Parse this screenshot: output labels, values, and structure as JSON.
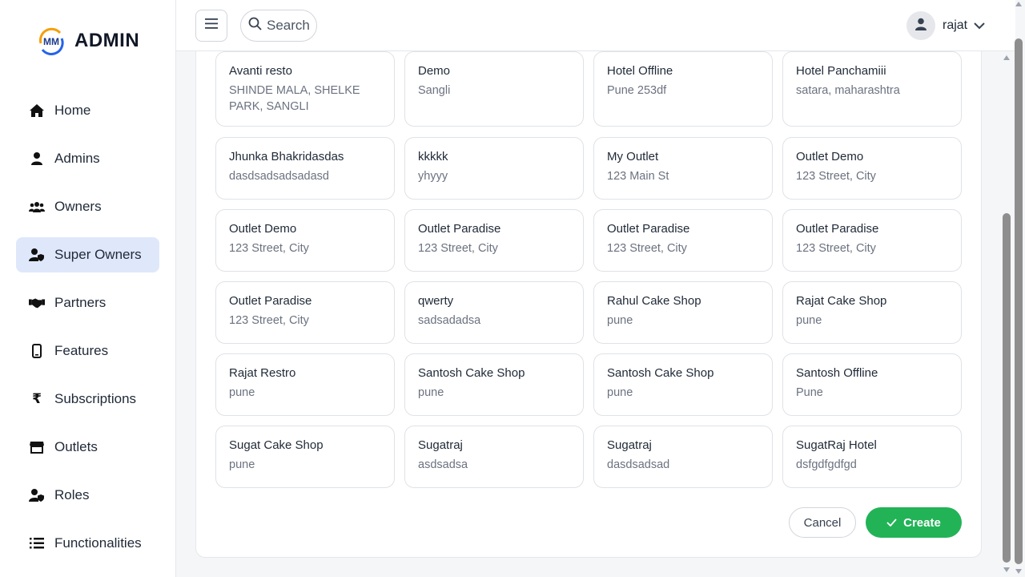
{
  "brand": {
    "logo_text": "MM",
    "title": "ADMIN"
  },
  "sidebar": {
    "items": [
      {
        "label": "Home",
        "icon": "home-icon",
        "active": false
      },
      {
        "label": "Admins",
        "icon": "user-icon",
        "active": false
      },
      {
        "label": "Owners",
        "icon": "users-icon",
        "active": false
      },
      {
        "label": "Super Owners",
        "icon": "user-shield-icon",
        "active": true
      },
      {
        "label": "Partners",
        "icon": "handshake-icon",
        "active": false
      },
      {
        "label": "Features",
        "icon": "mobile-icon",
        "active": false
      },
      {
        "label": "Subscriptions",
        "icon": "rupee-icon",
        "active": false
      },
      {
        "label": "Outlets",
        "icon": "store-icon",
        "active": false
      },
      {
        "label": "Roles",
        "icon": "user-shield-icon",
        "active": false
      },
      {
        "label": "Functionalities",
        "icon": "list-icon",
        "active": false
      }
    ]
  },
  "header": {
    "search_placeholder": "Search",
    "username": "rajat"
  },
  "outlets": [
    {
      "name": "Avanti resto",
      "address": "SHINDE MALA, SHELKE PARK, SANGLI"
    },
    {
      "name": "Demo",
      "address": "Sangli"
    },
    {
      "name": "Hotel Offline",
      "address": "Pune 253df"
    },
    {
      "name": "Hotel Panchamiii",
      "address": "satara, maharashtra"
    },
    {
      "name": "Jhunka Bhakridasdas",
      "address": "dasdsadsadsadasd"
    },
    {
      "name": "kkkkk",
      "address": "yhyyy"
    },
    {
      "name": "My Outlet",
      "address": "123 Main St"
    },
    {
      "name": "Outlet Demo",
      "address": "123 Street, City"
    },
    {
      "name": "Outlet Demo",
      "address": "123 Street, City"
    },
    {
      "name": "Outlet Paradise",
      "address": "123 Street, City"
    },
    {
      "name": "Outlet Paradise",
      "address": "123 Street, City"
    },
    {
      "name": "Outlet Paradise",
      "address": "123 Street, City"
    },
    {
      "name": "Outlet Paradise",
      "address": "123 Street, City"
    },
    {
      "name": "qwerty",
      "address": "sadsadadsa"
    },
    {
      "name": "Rahul Cake Shop",
      "address": "pune"
    },
    {
      "name": "Rajat Cake Shop",
      "address": "pune"
    },
    {
      "name": "Rajat Restro",
      "address": "pune"
    },
    {
      "name": "Santosh Cake Shop",
      "address": "pune"
    },
    {
      "name": "Santosh Cake Shop",
      "address": "pune"
    },
    {
      "name": "Santosh Offline",
      "address": "Pune"
    },
    {
      "name": "Sugat Cake Shop",
      "address": "pune"
    },
    {
      "name": "Sugatraj",
      "address": "asdsadsa"
    },
    {
      "name": "Sugatraj",
      "address": "dasdsadsad"
    },
    {
      "name": "SugatRaj Hotel",
      "address": "dsfgdfgdfgd"
    }
  ],
  "actions": {
    "cancel_label": "Cancel",
    "create_label": "Create"
  },
  "colors": {
    "accent_active": "#dfe8fb",
    "create_green": "#22b357"
  }
}
